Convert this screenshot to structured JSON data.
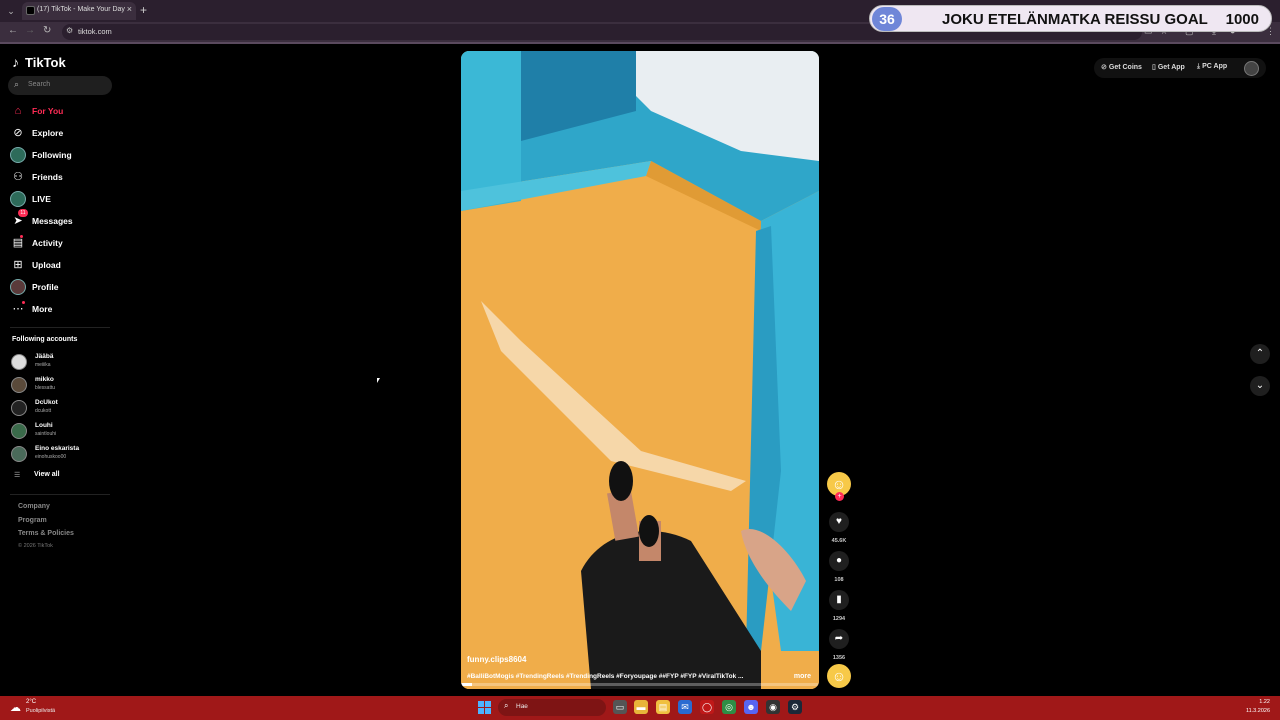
{
  "browser": {
    "tab_title": "(17) TikTok - Make Your Day",
    "url": "tiktok.com"
  },
  "goal_overlay": {
    "current": "36",
    "title": "JOKU ETELÄNMATKA REISSU GOAL",
    "target": "1000"
  },
  "app": {
    "logo_text": "TikTok"
  },
  "search": {
    "placeholder": "Search"
  },
  "nav": {
    "for_you": "For You",
    "explore": "Explore",
    "following": "Following",
    "friends": "Friends",
    "live": "LIVE",
    "messages": "Messages",
    "messages_badge": "11",
    "activity": "Activity",
    "upload": "Upload",
    "profile": "Profile",
    "more": "More"
  },
  "following_accounts": {
    "title": "Following accounts",
    "accounts": [
      {
        "name": "Jääbä",
        "handle": "meiiika"
      },
      {
        "name": "mikko",
        "handle": "blessattu"
      },
      {
        "name": "DcUkot",
        "handle": "dcukott"
      },
      {
        "name": "Louhi",
        "handle": "saintlouhi"
      },
      {
        "name": "Eino eskarista",
        "handle": "einohuskoo00"
      }
    ],
    "view_all": "View all"
  },
  "footer": {
    "company": "Company",
    "program": "Program",
    "terms": "Terms & Policies",
    "copyright": "© 2026 TikTok"
  },
  "top_actions": {
    "get_coins": "Get Coins",
    "get_app": "Get App",
    "pc_app": "PC App"
  },
  "video": {
    "author": "funny.clips8604",
    "caption": "#BalliBotMogis #TrendingReels #TrendingReels #Foryoupage ##FYP #FYP #ViralTikTok ...",
    "more": "more",
    "progress": 0.03
  },
  "actions": {
    "likes": "45.6K",
    "comments": "108",
    "saves": "1294",
    "shares": "1356"
  },
  "taskbar": {
    "temperature": "2°C",
    "weather": "Puolipilvistä",
    "search_placeholder": "Hae",
    "time": "1.22",
    "date": "11.3.2026"
  }
}
